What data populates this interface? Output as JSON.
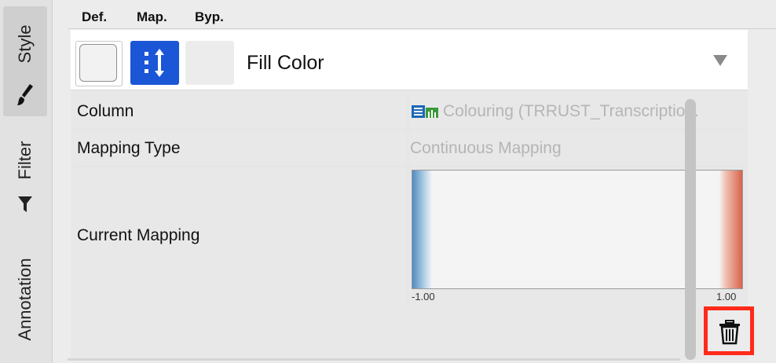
{
  "tabs": [
    {
      "label": "Style",
      "icon": "brush-icon"
    },
    {
      "label": "Filter",
      "icon": "funnel-icon"
    },
    {
      "label": "Annotation",
      "icon": ""
    }
  ],
  "column_headers": {
    "def": "Def.",
    "map": "Map.",
    "byp": "Byp."
  },
  "property": {
    "name": "Fill Color",
    "map_icon": "continuous-mapping-icon"
  },
  "rows": {
    "column": {
      "key": "Column",
      "value": "Colouring (TRRUST_Transcriptio...",
      "icon": "column-type-icon"
    },
    "mapping_type": {
      "key": "Mapping Type",
      "value": "Continuous Mapping"
    },
    "current_mapping": {
      "key": "Current Mapping",
      "min": "-1.00",
      "max": "1.00"
    }
  },
  "colors": {
    "map_button": "#1a56d6",
    "low": "#4f8cc0",
    "high": "#d8634c",
    "highlight": "#ff2a1a"
  },
  "actions": {
    "delete_icon": "trash-icon"
  }
}
